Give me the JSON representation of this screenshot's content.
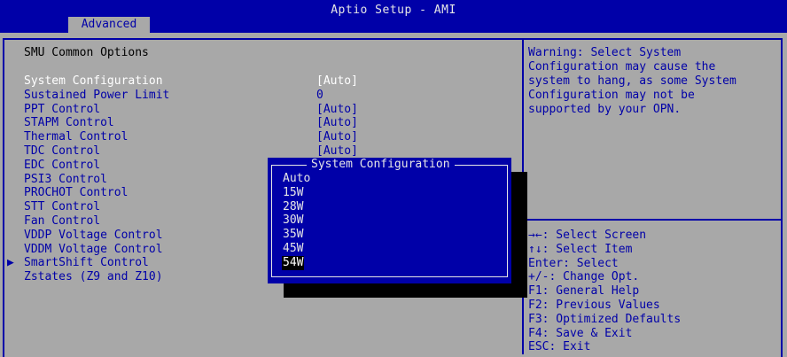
{
  "header": {
    "title": "Aptio Setup - AMI",
    "tab": "Advanced"
  },
  "main": {
    "section_title": "SMU Common Options",
    "items": [
      {
        "label": "System Configuration",
        "value": "[Auto]",
        "selected": true
      },
      {
        "label": "Sustained Power Limit",
        "value": "0"
      },
      {
        "label": "PPT Control",
        "value": "[Auto]"
      },
      {
        "label": "STAPM Control",
        "value": "[Auto]"
      },
      {
        "label": "Thermal Control",
        "value": "[Auto]"
      },
      {
        "label": "TDC Control",
        "value": "[Auto]"
      },
      {
        "label": "EDC Control",
        "value": ""
      },
      {
        "label": "PSI3 Control",
        "value": ""
      },
      {
        "label": "PROCHOT Control",
        "value": ""
      },
      {
        "label": "STT Control",
        "value": ""
      },
      {
        "label": "Fan Control",
        "value": ""
      },
      {
        "label": "VDDP Voltage Control",
        "value": ""
      },
      {
        "label": "VDDM Voltage Control",
        "value": ""
      },
      {
        "label": "SmartShift Control",
        "value": "",
        "submenu": true
      },
      {
        "label": "Zstates (Z9 and Z10)",
        "value": ""
      }
    ],
    "submenu_marker": "▶"
  },
  "help": {
    "text": "Warning: Select System\nConfiguration may cause the\nsystem to hang, as some System\nConfiguration may not be\nsupported by your OPN."
  },
  "keys": [
    "→←: Select Screen",
    "↑↓: Select Item",
    "Enter: Select",
    "+/-: Change Opt.",
    "F1: General Help",
    "F2: Previous Values",
    "F3: Optimized Defaults",
    "F4: Save & Exit",
    "ESC: Exit"
  ],
  "popup": {
    "title": "System Configuration",
    "options": [
      "Auto",
      "15W",
      "28W",
      "30W",
      "35W",
      "45W",
      "54W"
    ],
    "selected_index": 6
  },
  "colors": {
    "background": "#a8a8a8",
    "accent": "#0000a8",
    "highlight_text": "#ffffff",
    "light_text": "#e6e6e6"
  }
}
